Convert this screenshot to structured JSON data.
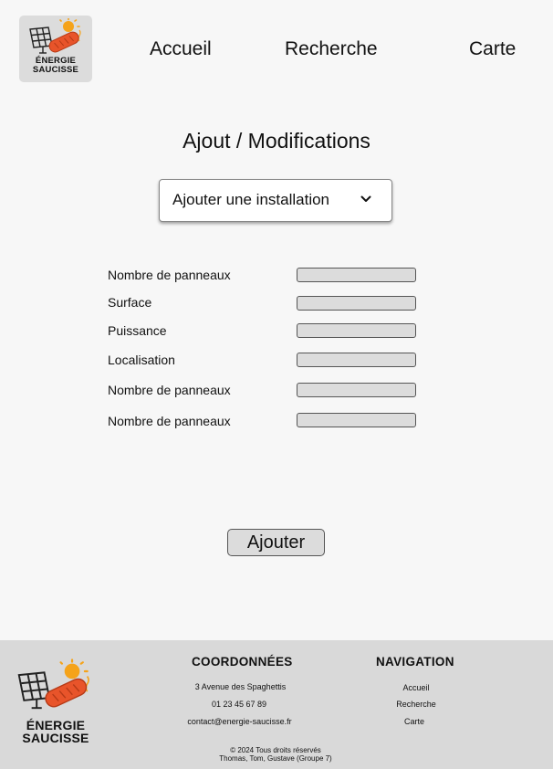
{
  "brand": {
    "name_line1": "ÉNERGIE",
    "name_line2": "SAUCISSE"
  },
  "nav": {
    "home": "Accueil",
    "search": "Recherche",
    "map": "Carte"
  },
  "main": {
    "title": "Ajout / Modifications",
    "action_select": {
      "selected": "Ajouter une installation"
    },
    "form": {
      "fields": [
        {
          "label": "Nombre de panneaux",
          "value": ""
        },
        {
          "label": "Surface",
          "value": ""
        },
        {
          "label": "Puissance",
          "value": ""
        },
        {
          "label": "Localisation",
          "value": ""
        },
        {
          "label": "Nombre de panneaux",
          "value": ""
        },
        {
          "label": "Nombre de panneaux",
          "value": ""
        }
      ],
      "submit_label": "Ajouter"
    }
  },
  "footer": {
    "contact": {
      "heading": "COORDONNÉES",
      "address": "3 Avenue des Spaghettis",
      "phone": "01 23 45 67 89",
      "email": "contact@energie-saucisse.fr"
    },
    "navigation": {
      "heading": "NAVIGATION",
      "links": [
        "Accueil",
        "Recherche",
        "Carte"
      ]
    },
    "copyright": "©  2024 Tous droits réservés",
    "credits": "Thomas, Tom, Gustave  (Groupe 7)"
  },
  "colors": {
    "page_bg": "#f7f7f7",
    "footer_bg": "#d9d9d9",
    "input_bg": "#dcdcdc",
    "sausage": "#e8542a",
    "sun": "#f5a31a"
  },
  "icons": {
    "logo": "solar-panel-sausage-sun-logo",
    "select": "chevron-down-icon"
  }
}
